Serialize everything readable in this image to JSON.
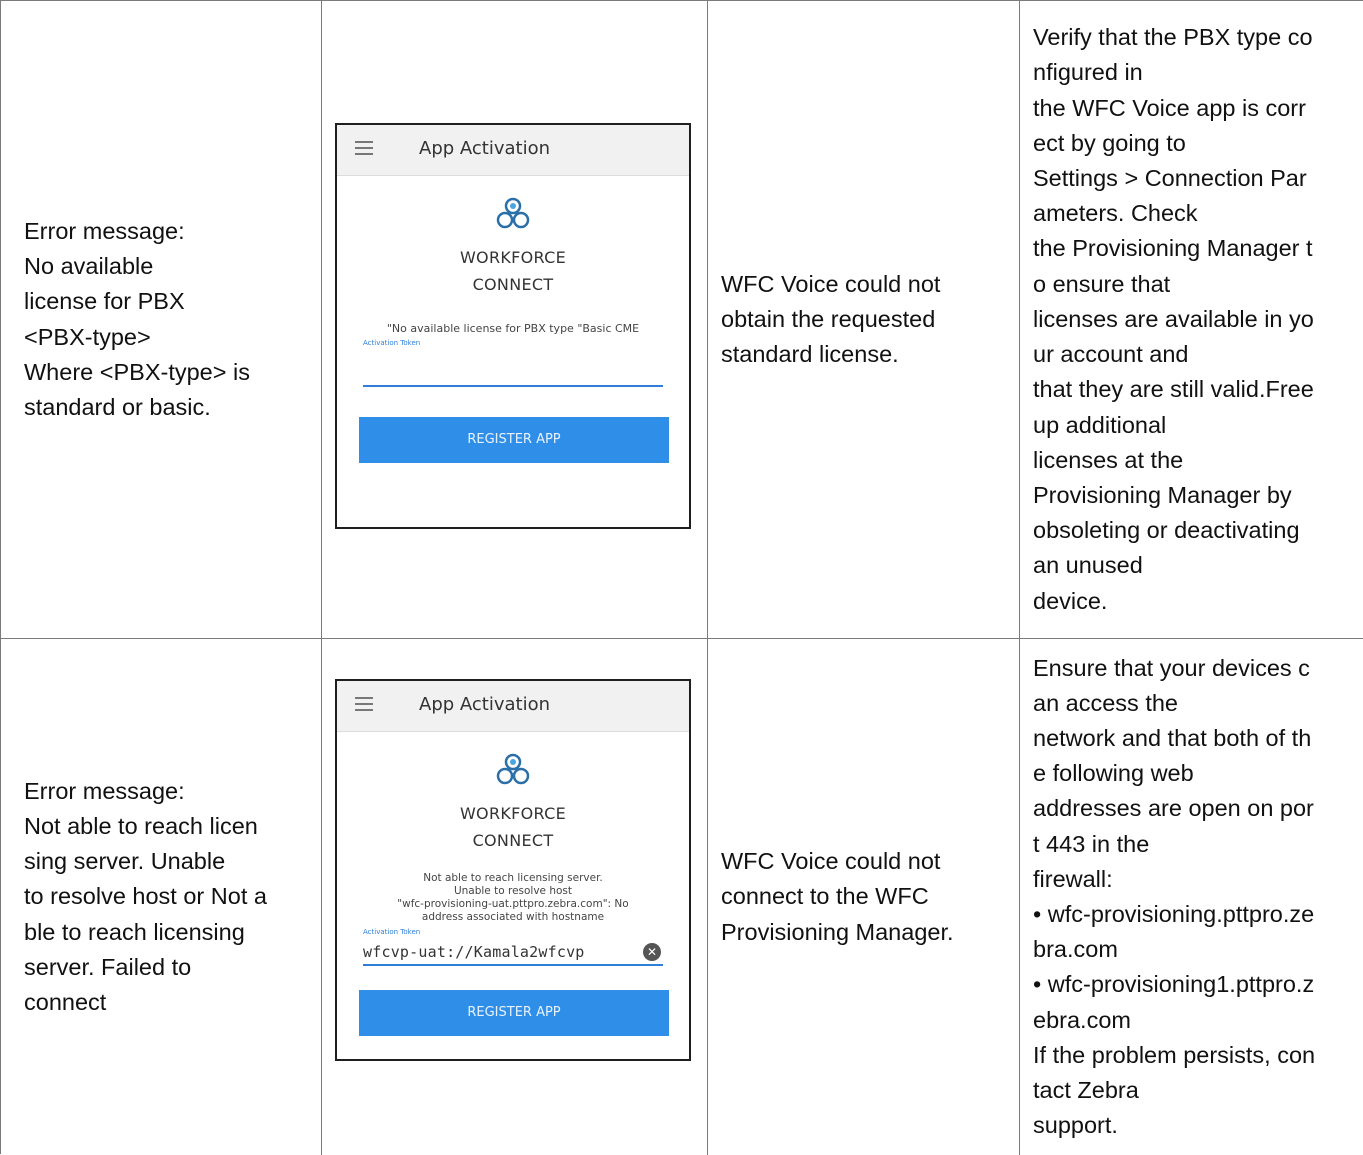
{
  "rows": [
    {
      "error_text": "Error message:\nNo available\nlicense for PBX\n<PBX-type>\nWhere <PBX-type> is\nstandard or basic.",
      "phone": {
        "title": "App Activation",
        "brand_line1": "WORKFORCE",
        "brand_line2": "CONNECT",
        "message": "\"No available license for PBX type \"Basic CME",
        "field_label": "Activation Token",
        "field_value": "",
        "register_label": "REGISTER APP"
      },
      "cause_text": "WFC Voice could not\nobtain the requested\nstandard license.",
      "resolution_text": "Verify that the PBX type co\nnfigured in\nthe WFC Voice app is corr\nect by going to\nSettings > Connection Par\nameters. Check\nthe Provisioning Manager t\no ensure that\nlicenses are available in yo\nur account and\nthat they are still valid.Free\nup additional\nlicenses at the\nProvisioning Manager by\nobsoleting or deactivating\nan unused\ndevice."
    },
    {
      "error_text": "Error message:\nNot able to  reach licen\nsing server. Unable\nto resolve host or Not a\nble to reach licensing\nserver. Failed to\nconnect",
      "phone": {
        "title": "App Activation",
        "brand_line1": "WORKFORCE",
        "brand_line2": "CONNECT",
        "message": "Not able to reach licensing server.\nUnable to resolve host\n\"wfc-provisioning-uat.pttpro.zebra.com\": No\naddress associated with hostname",
        "field_label": "Activation Token",
        "field_value": "wfcvp-uat://Kamala2wfcvp",
        "register_label": "REGISTER APP"
      },
      "cause_text": "WFC Voice could not\nconnect to the WFC\nProvisioning Manager.",
      "resolution_text": "Ensure that your devices c\nan access the\nnetwork and that both of th\ne following web\naddresses are open on por\nt 443 in the\nfirewall:\n• wfc-provisioning.pttpro.ze\nbra.com\n• wfc-provisioning1.pttpro.z\nebra.com\nIf the problem persists, con\ntact Zebra\nsupport."
    }
  ],
  "colors": {
    "accent": "#2f8fe8",
    "border": "#7a7a7a"
  },
  "icons": [
    "menu-icon",
    "workforce-connect-logo-icon",
    "clear-icon"
  ]
}
